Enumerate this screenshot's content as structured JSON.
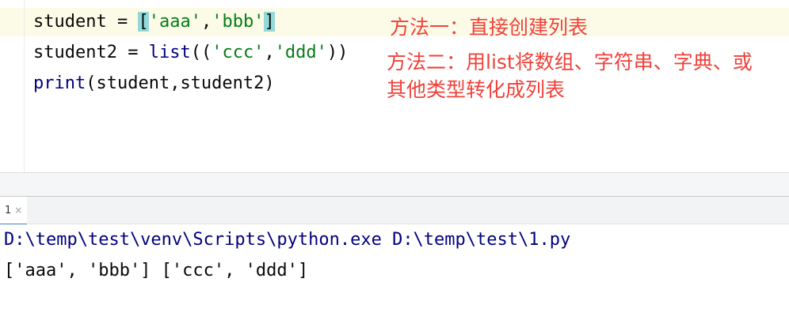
{
  "editor": {
    "lines": [
      {
        "var": "student",
        "op": " = ",
        "open": "[",
        "s1": "'aaa'",
        "comma": ",",
        "s2": "'bbb'",
        "close": "]"
      },
      {
        "var": "student2",
        "op": " = ",
        "fn": "list",
        "open": "((",
        "s1": "'ccc'",
        "comma": ",",
        "s2": "'ddd'",
        "close": "))"
      },
      {
        "fn": "print",
        "args": "(student,student2)"
      }
    ],
    "annotations": [
      "方法一：直接创建列表",
      "方法二：用list将数组、字符串、字典、或",
      "其他类型转化成列表"
    ]
  },
  "run_panel": {
    "tab_label": "1",
    "close_glyph": "×",
    "output": [
      "D:\\temp\\test\\venv\\Scripts\\python.exe D:\\temp\\test\\1.py",
      "['aaa', 'bbb'] ['ccc', 'ddd']"
    ]
  },
  "colors": {
    "string": "#067d17",
    "function": "#000080",
    "annotation": "#f0413a",
    "bracket_highlight": "#93d9d9",
    "current_line": "#fcfbe7"
  }
}
